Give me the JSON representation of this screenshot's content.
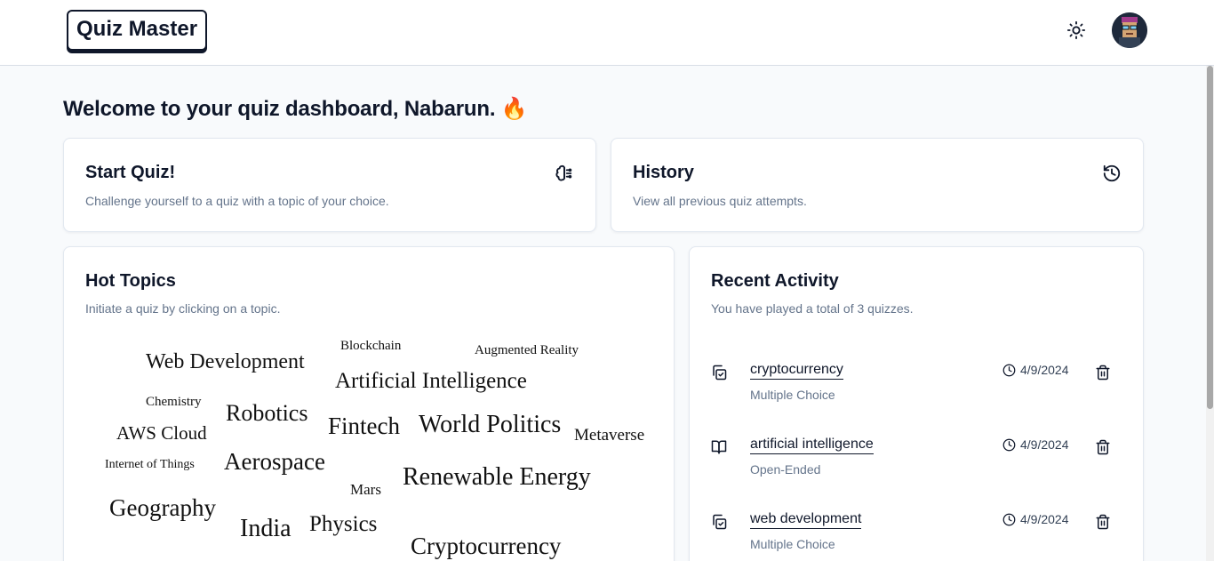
{
  "app": {
    "title": "Quiz Master"
  },
  "header": {
    "theme_icon": "sun-icon",
    "avatar_icon": "user-avatar"
  },
  "welcome": {
    "text": "Welcome to your quiz dashboard, Nabarun.",
    "emoji": "🔥"
  },
  "start_quiz": {
    "title": "Start Quiz!",
    "description": "Challenge yourself to a quiz with a topic of your choice.",
    "icon": "brain-icon"
  },
  "history": {
    "title": "History",
    "description": "View all previous quiz attempts.",
    "icon": "history-icon"
  },
  "hot_topics": {
    "title": "Hot Topics",
    "description": "Initiate a quiz by clicking on a topic.",
    "words": [
      {
        "text": "Web Development",
        "size": 24
      },
      {
        "text": "Blockchain",
        "size": 15
      },
      {
        "text": "Augmented Reality",
        "size": 15
      },
      {
        "text": "Artificial Intelligence",
        "size": 25
      },
      {
        "text": "Chemistry",
        "size": 15
      },
      {
        "text": "Robotics",
        "size": 26
      },
      {
        "text": "AWS Cloud",
        "size": 21
      },
      {
        "text": "Fintech",
        "size": 27
      },
      {
        "text": "World Politics",
        "size": 28
      },
      {
        "text": "Metaverse",
        "size": 19
      },
      {
        "text": "Internet of Things",
        "size": 14
      },
      {
        "text": "Aerospace",
        "size": 27
      },
      {
        "text": "Mars",
        "size": 17
      },
      {
        "text": "Renewable Energy",
        "size": 28
      },
      {
        "text": "Geography",
        "size": 27
      },
      {
        "text": "India",
        "size": 28
      },
      {
        "text": "Physics",
        "size": 25
      },
      {
        "text": "Cryptocurrency",
        "size": 27
      }
    ]
  },
  "recent_activity": {
    "title": "Recent Activity",
    "description": "You have played a total of 3 quizzes.",
    "items": [
      {
        "topic": "cryptocurrency",
        "type": "Multiple Choice",
        "date": "4/9/2024",
        "icon": "copy-check-icon"
      },
      {
        "topic": "artificial intelligence",
        "type": "Open-Ended",
        "date": "4/9/2024",
        "icon": "book-open-icon"
      },
      {
        "topic": "web development",
        "type": "Multiple Choice",
        "date": "4/9/2024",
        "icon": "copy-check-icon"
      }
    ]
  }
}
